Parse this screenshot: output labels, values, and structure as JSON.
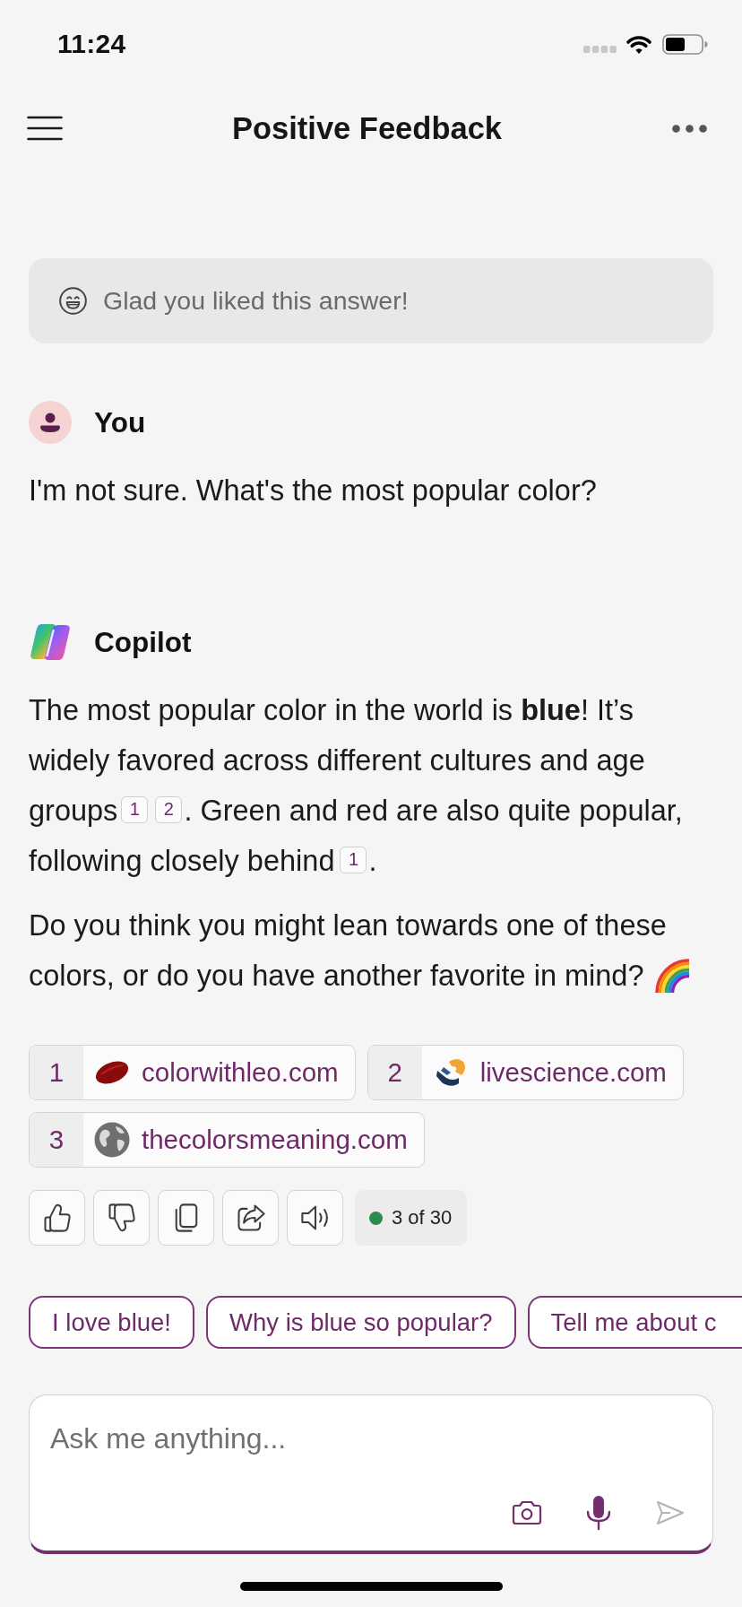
{
  "status_bar": {
    "time": "11:24"
  },
  "header": {
    "title": "Positive Feedback"
  },
  "feedback_banner": {
    "text": "Glad you liked this answer!"
  },
  "messages": [
    {
      "kind": "user",
      "author": "You",
      "paragraphs": [
        [
          {
            "kind": "text",
            "text": "I'm not sure. What's the most popular color?"
          }
        ]
      ]
    },
    {
      "kind": "assistant",
      "author": "Copilot",
      "paragraphs": [
        [
          {
            "kind": "text",
            "text": "The most popular color in the world is **blue**! It’s widely favored across different cultures and age groups"
          },
          {
            "kind": "cite",
            "text": "1"
          },
          {
            "kind": "cite",
            "text": "2"
          },
          {
            "kind": "text",
            "text": ". Green and red are also quite popular, following closely behind"
          },
          {
            "kind": "cite",
            "text": "1"
          },
          {
            "kind": "text",
            "text": "."
          }
        ],
        [
          {
            "kind": "text",
            "text": "Do you think you might lean towards one of these colors, or do you have another favorite in mind?"
          },
          {
            "kind": "emoji"
          }
        ]
      ],
      "sources": [
        {
          "number": "1",
          "domain": "colorwithleo.com"
        },
        {
          "number": "2",
          "domain": "livescience.com"
        },
        {
          "number": "3",
          "domain": "thecolorsmeaning.com"
        }
      ],
      "turn_counter": "3 of 30"
    }
  ],
  "suggestions": [
    "I love blue!",
    "Why is blue so popular?",
    "Tell me about c"
  ],
  "composer": {
    "placeholder": "Ask me anything..."
  }
}
